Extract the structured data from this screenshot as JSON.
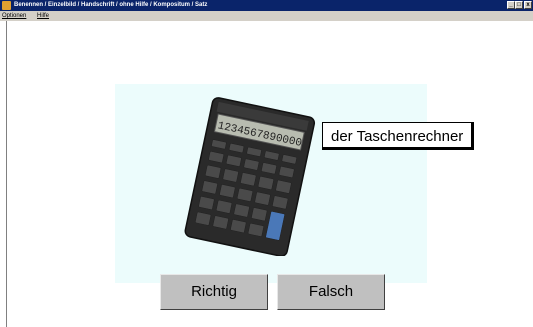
{
  "window": {
    "title": "Benennen / Einzelbild / Handschrift / ohne Hilfe / Kompositum / Satz",
    "buttons": [
      "_",
      "□",
      "x"
    ]
  },
  "menu": {
    "items": [
      "Optionen",
      "Hilfe"
    ]
  },
  "exercise": {
    "word": "der Taschenrechner",
    "image_icon": "calculator-image",
    "calculator_display": "1234567890000"
  },
  "answers": {
    "correct_label": "Richtig",
    "wrong_label": "Falsch"
  }
}
